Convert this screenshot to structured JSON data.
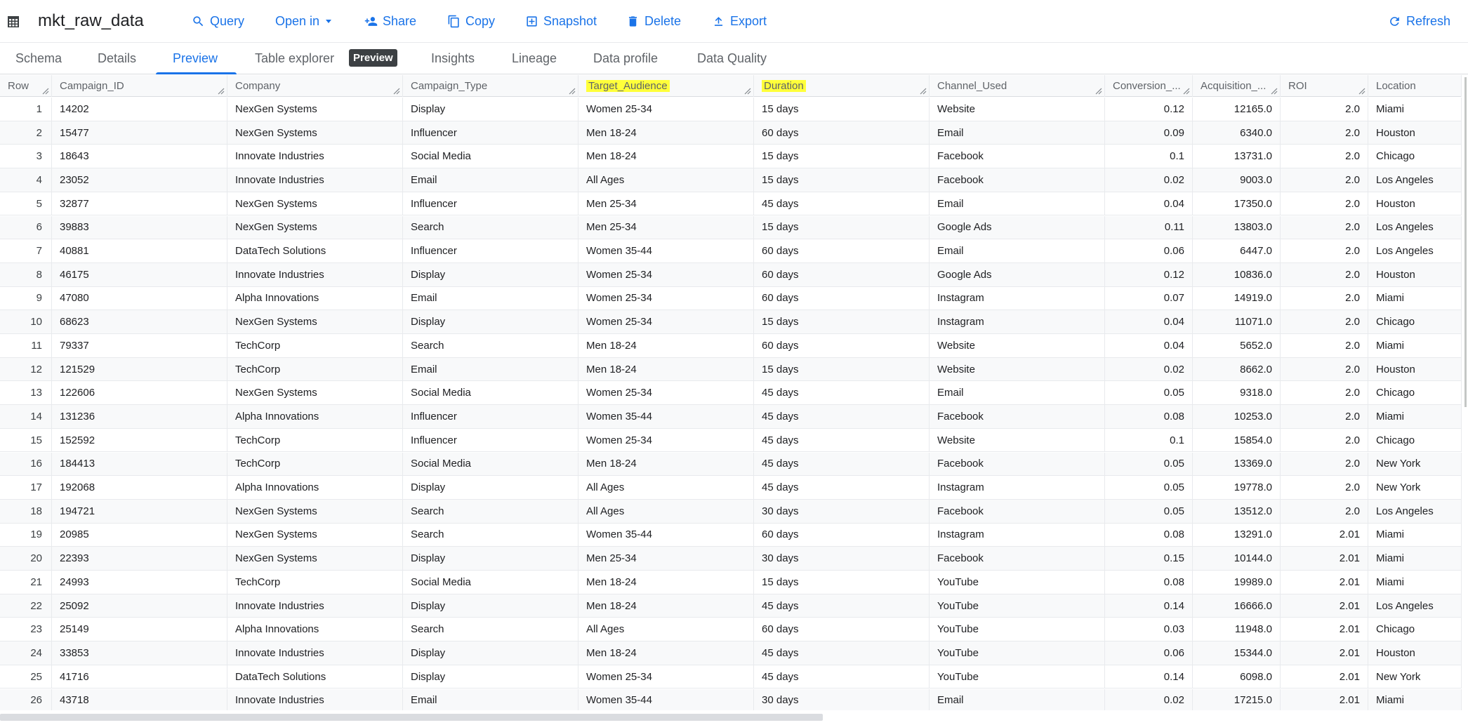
{
  "toolbar": {
    "title": "mkt_raw_data",
    "query": "Query",
    "open_in": "Open in",
    "share": "Share",
    "copy": "Copy",
    "snapshot": "Snapshot",
    "delete": "Delete",
    "export": "Export",
    "refresh": "Refresh"
  },
  "tabs": {
    "schema": "Schema",
    "details": "Details",
    "preview": "Preview",
    "table_explorer": "Table explorer",
    "table_explorer_badge": "Preview",
    "insights": "Insights",
    "lineage": "Lineage",
    "data_profile": "Data profile",
    "data_quality": "Data Quality"
  },
  "colors": {
    "accent": "#1a73e8",
    "highlight": "#ffff3a"
  },
  "grid": {
    "headers": [
      "Row",
      "Campaign_ID",
      "Company",
      "Campaign_Type",
      "Target_Audience",
      "Duration",
      "Channel_Used",
      "Conversion_...",
      "Acquisition_...",
      "ROI",
      "Location"
    ],
    "rows": [
      [
        "1",
        "14202",
        "NexGen Systems",
        "Display",
        "Women 25-34",
        "15 days",
        "Website",
        "0.12",
        "12165.0",
        "2.0",
        "Miami"
      ],
      [
        "2",
        "15477",
        "NexGen Systems",
        "Influencer",
        "Men 18-24",
        "60 days",
        "Email",
        "0.09",
        "6340.0",
        "2.0",
        "Houston"
      ],
      [
        "3",
        "18643",
        "Innovate Industries",
        "Social Media",
        "Men 18-24",
        "15 days",
        "Facebook",
        "0.1",
        "13731.0",
        "2.0",
        "Chicago"
      ],
      [
        "4",
        "23052",
        "Innovate Industries",
        "Email",
        "All Ages",
        "15 days",
        "Facebook",
        "0.02",
        "9003.0",
        "2.0",
        "Los Angeles"
      ],
      [
        "5",
        "32877",
        "NexGen Systems",
        "Influencer",
        "Men 25-34",
        "45 days",
        "Email",
        "0.04",
        "17350.0",
        "2.0",
        "Houston"
      ],
      [
        "6",
        "39883",
        "NexGen Systems",
        "Search",
        "Men 25-34",
        "15 days",
        "Google Ads",
        "0.11",
        "13803.0",
        "2.0",
        "Los Angeles"
      ],
      [
        "7",
        "40881",
        "DataTech Solutions",
        "Influencer",
        "Women 35-44",
        "60 days",
        "Email",
        "0.06",
        "6447.0",
        "2.0",
        "Los Angeles"
      ],
      [
        "8",
        "46175",
        "Innovate Industries",
        "Display",
        "Women 25-34",
        "60 days",
        "Google Ads",
        "0.12",
        "10836.0",
        "2.0",
        "Houston"
      ],
      [
        "9",
        "47080",
        "Alpha Innovations",
        "Email",
        "Women 25-34",
        "60 days",
        "Instagram",
        "0.07",
        "14919.0",
        "2.0",
        "Miami"
      ],
      [
        "10",
        "68623",
        "NexGen Systems",
        "Display",
        "Women 25-34",
        "15 days",
        "Instagram",
        "0.04",
        "11071.0",
        "2.0",
        "Chicago"
      ],
      [
        "11",
        "79337",
        "TechCorp",
        "Search",
        "Men 18-24",
        "60 days",
        "Website",
        "0.04",
        "5652.0",
        "2.0",
        "Miami"
      ],
      [
        "12",
        "121529",
        "TechCorp",
        "Email",
        "Men 18-24",
        "15 days",
        "Website",
        "0.02",
        "8662.0",
        "2.0",
        "Houston"
      ],
      [
        "13",
        "122606",
        "NexGen Systems",
        "Social Media",
        "Women 25-34",
        "45 days",
        "Email",
        "0.05",
        "9318.0",
        "2.0",
        "Chicago"
      ],
      [
        "14",
        "131236",
        "Alpha Innovations",
        "Influencer",
        "Women 35-44",
        "45 days",
        "Facebook",
        "0.08",
        "10253.0",
        "2.0",
        "Miami"
      ],
      [
        "15",
        "152592",
        "TechCorp",
        "Influencer",
        "Women 25-34",
        "45 days",
        "Website",
        "0.1",
        "15854.0",
        "2.0",
        "Chicago"
      ],
      [
        "16",
        "184413",
        "TechCorp",
        "Social Media",
        "Men 18-24",
        "45 days",
        "Facebook",
        "0.05",
        "13369.0",
        "2.0",
        "New York"
      ],
      [
        "17",
        "192068",
        "Alpha Innovations",
        "Display",
        "All Ages",
        "45 days",
        "Instagram",
        "0.05",
        "19778.0",
        "2.0",
        "New York"
      ],
      [
        "18",
        "194721",
        "NexGen Systems",
        "Search",
        "All Ages",
        "30 days",
        "Facebook",
        "0.05",
        "13512.0",
        "2.0",
        "Los Angeles"
      ],
      [
        "19",
        "20985",
        "NexGen Systems",
        "Search",
        "Women 35-44",
        "60 days",
        "Instagram",
        "0.08",
        "13291.0",
        "2.01",
        "Miami"
      ],
      [
        "20",
        "22393",
        "NexGen Systems",
        "Display",
        "Men 25-34",
        "30 days",
        "Facebook",
        "0.15",
        "10144.0",
        "2.01",
        "Miami"
      ],
      [
        "21",
        "24993",
        "TechCorp",
        "Social Media",
        "Men 18-24",
        "15 days",
        "YouTube",
        "0.08",
        "19989.0",
        "2.01",
        "Miami"
      ],
      [
        "22",
        "25092",
        "Innovate Industries",
        "Display",
        "Men 18-24",
        "45 days",
        "YouTube",
        "0.14",
        "16666.0",
        "2.01",
        "Los Angeles"
      ],
      [
        "23",
        "25149",
        "Alpha Innovations",
        "Search",
        "All Ages",
        "60 days",
        "YouTube",
        "0.03",
        "11948.0",
        "2.01",
        "Chicago"
      ],
      [
        "24",
        "33853",
        "Innovate Industries",
        "Display",
        "Men 18-24",
        "45 days",
        "YouTube",
        "0.06",
        "15344.0",
        "2.01",
        "Houston"
      ],
      [
        "25",
        "41716",
        "DataTech Solutions",
        "Display",
        "Women 25-34",
        "45 days",
        "YouTube",
        "0.14",
        "6098.0",
        "2.01",
        "New York"
      ],
      [
        "26",
        "43718",
        "Innovate Industries",
        "Email",
        "Women 35-44",
        "30 days",
        "Email",
        "0.02",
        "17215.0",
        "2.01",
        "Miami"
      ]
    ]
  }
}
